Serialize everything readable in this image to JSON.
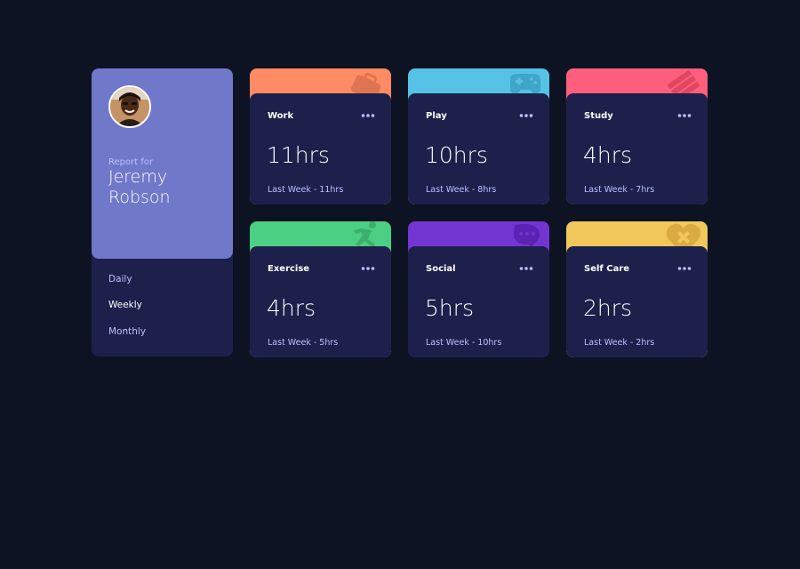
{
  "profile": {
    "report_for": "Report for",
    "name": "Jeremy Robson",
    "timeframes": [
      "Daily",
      "Weekly",
      "Monthly"
    ],
    "active_timeframe": "Weekly"
  },
  "cards": [
    {
      "title": "Work",
      "hours": "11hrs",
      "previous": "Last Week - 11hrs",
      "color": "#ff8b64",
      "icon": "briefcase-icon"
    },
    {
      "title": "Play",
      "hours": "10hrs",
      "previous": "Last Week - 8hrs",
      "color": "#55c2e6",
      "icon": "gamepad-icon"
    },
    {
      "title": "Study",
      "hours": "4hrs",
      "previous": "Last Week - 7hrs",
      "color": "#ff5e7d",
      "icon": "books-icon"
    },
    {
      "title": "Exercise",
      "hours": "4hrs",
      "previous": "Last Week - 5hrs",
      "color": "#4bcf82",
      "icon": "running-icon"
    },
    {
      "title": "Social",
      "hours": "5hrs",
      "previous": "Last Week - 10hrs",
      "color": "#7335d2",
      "icon": "chat-icon"
    },
    {
      "title": "Self Care",
      "hours": "2hrs",
      "previous": "Last Week - 2hrs",
      "color": "#f1c75b",
      "icon": "heart-icon"
    }
  ]
}
